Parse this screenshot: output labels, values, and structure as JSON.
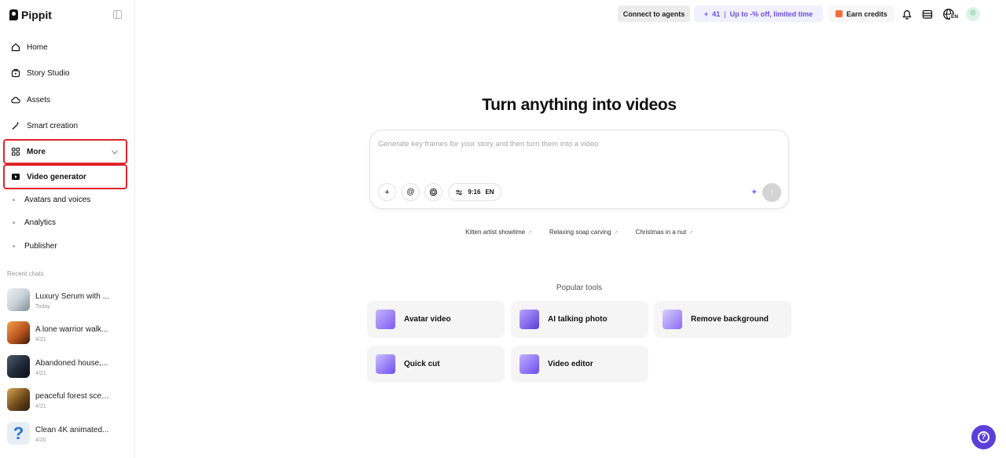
{
  "app": {
    "name": "Pippit"
  },
  "sidebar": {
    "items": [
      {
        "label": "Home",
        "icon": "home-icon"
      },
      {
        "label": "Story Studio",
        "icon": "story-icon"
      },
      {
        "label": "Assets",
        "icon": "cloud-icon"
      },
      {
        "label": "Smart creation",
        "icon": "magic-wand-icon"
      },
      {
        "label": "More",
        "icon": "grid-icon"
      },
      {
        "label": "Video generator",
        "icon": "video-generator-icon"
      }
    ],
    "sub_items": [
      "Avatars and voices",
      "Analytics",
      "Publisher"
    ],
    "recent_label": "Recent chats",
    "recent_chats": [
      {
        "title": "Luxury Serum with ...",
        "date": "Today"
      },
      {
        "title": "A lone warrior walk...",
        "date": "4/21"
      },
      {
        "title": "Abandoned house,...",
        "date": "4/21"
      },
      {
        "title": "peaceful forest scene",
        "date": "4/21"
      },
      {
        "title": "Clean 4K animated...",
        "date": "4/20"
      }
    ]
  },
  "topbar": {
    "connect_label": "Connect to agents",
    "credits_prefix": "+",
    "credits_count": "41",
    "promo_text": "Up to -% off, limited time",
    "earn_label": "Earn credits",
    "language": "EN"
  },
  "main": {
    "headline": "Turn anything into videos",
    "prompt_placeholder": "Generate key frames for your story and then turn them into a video",
    "aspect_ratio": "9:16",
    "prompt_language": "EN",
    "suggestions": [
      "Kitten artist showtime",
      "Relaxing soap carving",
      "Christmas in a nut"
    ],
    "popular_label": "Popular tools",
    "tools": [
      {
        "label": "Avatar video"
      },
      {
        "label": "AI talking photo"
      },
      {
        "label": "Remove background"
      },
      {
        "label": "Quick cut"
      },
      {
        "label": "Video editor"
      }
    ]
  },
  "colors": {
    "accent": "#5b3fd9",
    "highlight_border": "#e0242b",
    "promo_text": "#6b4de6"
  }
}
